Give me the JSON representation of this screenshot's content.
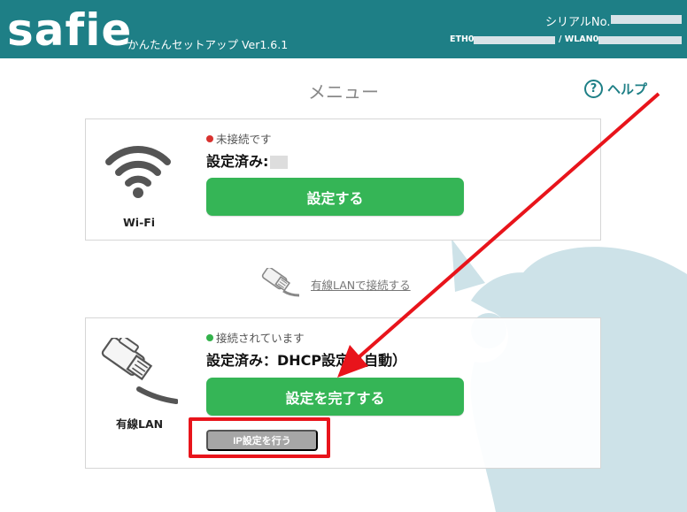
{
  "header": {
    "logo": "safie",
    "subtitle": "かんたんセットアップ Ver1.6.1",
    "serial_label": "シリアルNo.",
    "eth_label": "ETH0",
    "wlan_label": "/ WLAN0",
    "background_color": "#1e7f86"
  },
  "page": {
    "title": "メニュー",
    "help_label": "ヘルプ",
    "help_icon": "question-circle-icon"
  },
  "wifi_card": {
    "icon": "wifi-icon",
    "device_label": "Wi-Fi",
    "status": "未接続です",
    "status_color": "#d8322f",
    "configured": "設定済み:",
    "button_label": "設定する"
  },
  "lan_link": {
    "icon": "lan-cable-icon",
    "label": "有線LANで接続する"
  },
  "lan_card": {
    "icon": "lan-cable-icon",
    "device_label": "有線LAN",
    "status": "接続されています",
    "status_color": "#33b24b",
    "configured": "設定済み：DHCP設定（自動）",
    "button_label": "設定を完了する",
    "ip_button_label": "IP設定を行う"
  },
  "colors": {
    "accent": "#1e7f86",
    "button_green": "#35b556",
    "annotation_red": "#e8141b",
    "mascot": "#cde2e8"
  }
}
